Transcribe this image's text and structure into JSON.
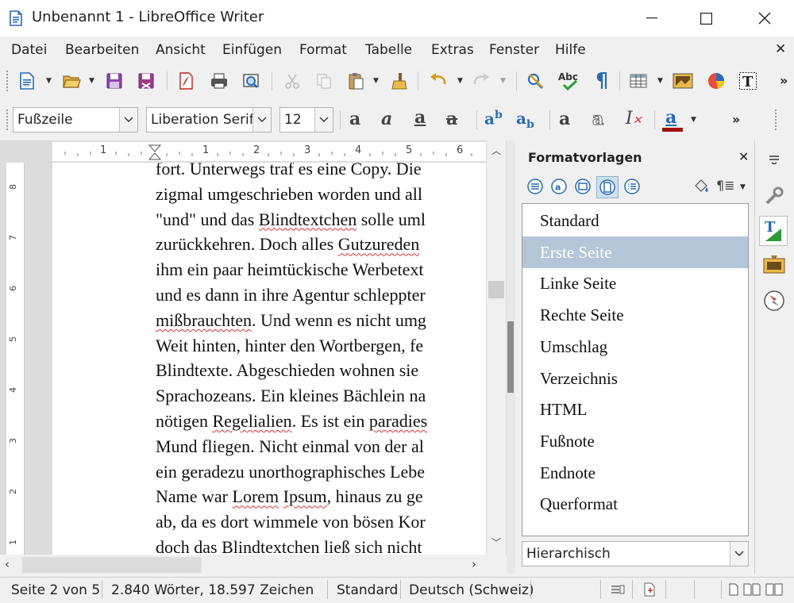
{
  "window": {
    "title": "Unbenannt 1 - LibreOffice Writer"
  },
  "menu": [
    "Datei",
    "Bearbeiten",
    "Ansicht",
    "Einfügen",
    "Format",
    "Tabelle",
    "Extras",
    "Fenster",
    "Hilfe"
  ],
  "formatting": {
    "paragraph_style": "Fußzeile",
    "font_name": "Liberation Serif",
    "font_size": "12"
  },
  "ruler": {
    "horizontal_ticks": [
      "1",
      "1",
      "2",
      "3",
      "4",
      "5",
      "6"
    ],
    "vertical_ticks": [
      "8",
      "7",
      "6",
      "5",
      "4",
      "3",
      "2",
      "1"
    ]
  },
  "document": {
    "lines": [
      [
        {
          "t": "fort. Unterwegs traf es eine Copy. Die"
        }
      ],
      [
        {
          "t": "zigmal umgeschrieben worden und all"
        }
      ],
      [
        {
          "t": "\"und\" und das "
        },
        {
          "t": "Blindtextchen",
          "sq": true
        },
        {
          "t": " solle uml"
        }
      ],
      [
        {
          "t": "zurückkehren. Doch alles "
        },
        {
          "t": "Gutzureden",
          "sq": true
        }
      ],
      [
        {
          "t": "ihm ein paar heimtückische Werbetext"
        }
      ],
      [
        {
          "t": "und es dann in ihre Agentur schleppter"
        }
      ],
      [
        {
          "t": "mißbrauchten",
          "sq": true
        },
        {
          "t": ". Und wenn es nicht umg"
        }
      ],
      [
        {
          "t": "Weit hinten, hinter den Wortbergen, fe"
        }
      ],
      [
        {
          "t": "Blindtexte. Abgeschieden wohnen sie"
        }
      ],
      [
        {
          "t": "Sprachozeans. Ein kleines Bächlein na"
        }
      ],
      [
        {
          "t": "nötigen "
        },
        {
          "t": "Regelialien",
          "sq": true
        },
        {
          "t": ". Es ist ein "
        },
        {
          "t": "paradies",
          "sq": true
        }
      ],
      [
        {
          "t": "Mund fliegen. Nicht einmal von der al"
        }
      ],
      [
        {
          "t": "ein geradezu unorthographisches Lebe"
        }
      ],
      [
        {
          "t": "Name war "
        },
        {
          "t": "Lorem",
          "sq": true
        },
        {
          "t": " "
        },
        {
          "t": "Ipsum",
          "sq": true
        },
        {
          "t": ", hinaus zu ge"
        }
      ],
      [
        {
          "t": "ab, da es dort wimmele von bösen Kor"
        }
      ],
      [
        {
          "t": "doch das "
        },
        {
          "t": "Blindtextchen",
          "sq": true
        },
        {
          "t": " "
        },
        {
          "t": "ließ",
          "sq": true
        },
        {
          "t": " sich nicht"
        }
      ]
    ]
  },
  "sidebar": {
    "title": "Formatvorlagen",
    "styles": [
      "Standard",
      "Erste Seite",
      "Linke Seite",
      "Rechte Seite",
      "Umschlag",
      "Verzeichnis",
      "HTML",
      "Fußnote",
      "Endnote",
      "Querformat"
    ],
    "selected_index": 1,
    "filter": "Hierarchisch"
  },
  "status": {
    "page": "Seite 2 von 5",
    "words": "2.840 Wörter, 18.597 Zeichen",
    "page_style": "Standard",
    "language": "Deutsch (Schweiz)"
  },
  "colors": {
    "accent": "#b4c6d7",
    "font_color_bar": "#a01010",
    "spell_underline": "#e03030"
  }
}
